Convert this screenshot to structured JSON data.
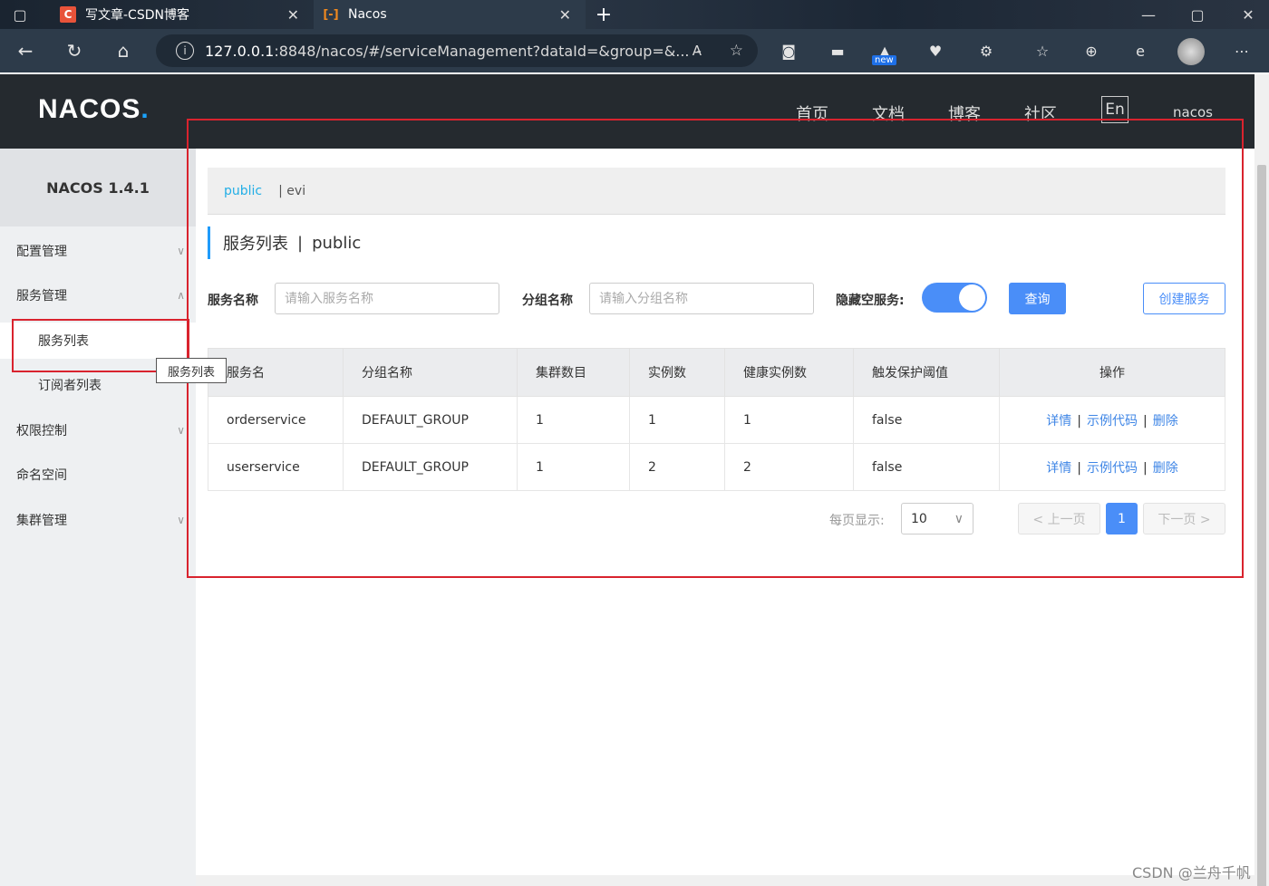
{
  "browser": {
    "tabs": [
      {
        "favicon": "C",
        "title": "写文章-CSDN博客"
      },
      {
        "favicon": "[-]",
        "title": "Nacos"
      }
    ],
    "url_host": "127.0.0.1",
    "url_rest": ":8848/nacos/#/serviceManagement?dataId=&group=&...",
    "read_aloud": "A̵",
    "ext_new_badge": "new"
  },
  "header": {
    "logo": "NACOS",
    "logo_dot": ".",
    "nav": [
      "首页",
      "文档",
      "博客",
      "社区"
    ],
    "lang": "En",
    "user": "nacos"
  },
  "sidebar": {
    "version": "NACOS 1.4.1",
    "items": [
      {
        "label": "配置管理"
      },
      {
        "label": "服务管理"
      },
      {
        "label": "服务列表"
      },
      {
        "label": "订阅者列表"
      },
      {
        "label": "权限控制"
      },
      {
        "label": "命名空间"
      },
      {
        "label": "集群管理"
      }
    ],
    "tooltip": "服务列表"
  },
  "main": {
    "namespaces": {
      "active": "public",
      "other": "| evi"
    },
    "title": "服务列表",
    "title_sep": "|",
    "title_ns": "public",
    "filters": {
      "service_label": "服务名称",
      "service_placeholder": "请输入服务名称",
      "group_label": "分组名称",
      "group_placeholder": "请输入分组名称",
      "hide_empty_label": "隐藏空服务:",
      "query_button": "查询",
      "create_button": "创建服务"
    },
    "table": {
      "headers": [
        "服务名",
        "分组名称",
        "集群数目",
        "实例数",
        "健康实例数",
        "触发保护阈值",
        "操作"
      ],
      "rows": [
        {
          "name": "orderservice",
          "group": "DEFAULT_GROUP",
          "clusters": "1",
          "instances": "1",
          "healthy": "1",
          "threshold": "false"
        },
        {
          "name": "userservice",
          "group": "DEFAULT_GROUP",
          "clusters": "1",
          "instances": "2",
          "healthy": "2",
          "threshold": "false"
        }
      ],
      "ops": {
        "detail": "详情",
        "sample": "示例代码",
        "delete": "删除",
        "sep": "|"
      }
    },
    "pager": {
      "label": "每页显示:",
      "size": "10",
      "prev": "< 上一页",
      "current": "1",
      "next": "下一页 >"
    }
  },
  "watermark": "CSDN @兰舟千帆"
}
